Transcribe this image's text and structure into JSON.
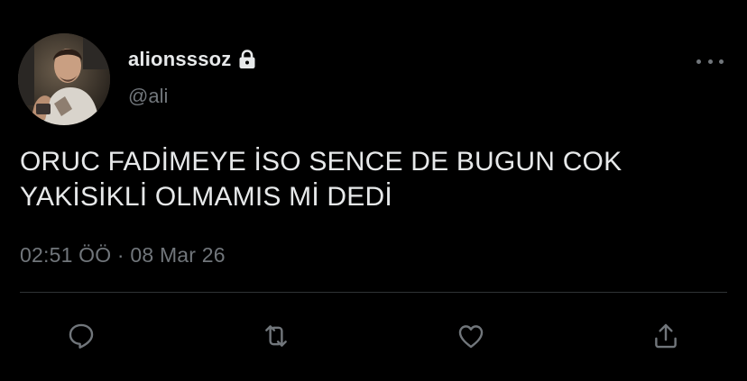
{
  "tweet": {
    "display_name": "alionsssoz",
    "handle": "@ali",
    "text_lines": [
      "ORUC FADİMEYE İSO SENCE DE BUGUN COK",
      "YAKİSİKLİ OLMAMIS Mİ DEDİ"
    ],
    "timestamp": "02:51 ÖÖ · 08 Mar 26",
    "protected_icon": "lock-icon",
    "more_icon": "more-horizontal-icon"
  },
  "actions": [
    {
      "name": "reply",
      "icon": "reply-icon"
    },
    {
      "name": "retweet",
      "icon": "retweet-icon"
    },
    {
      "name": "like",
      "icon": "heart-icon"
    },
    {
      "name": "share",
      "icon": "share-icon"
    }
  ],
  "colors": {
    "background": "#000000",
    "primary_text": "#e7e9ea",
    "secondary_text": "#71767b",
    "divider": "#2f3336"
  }
}
